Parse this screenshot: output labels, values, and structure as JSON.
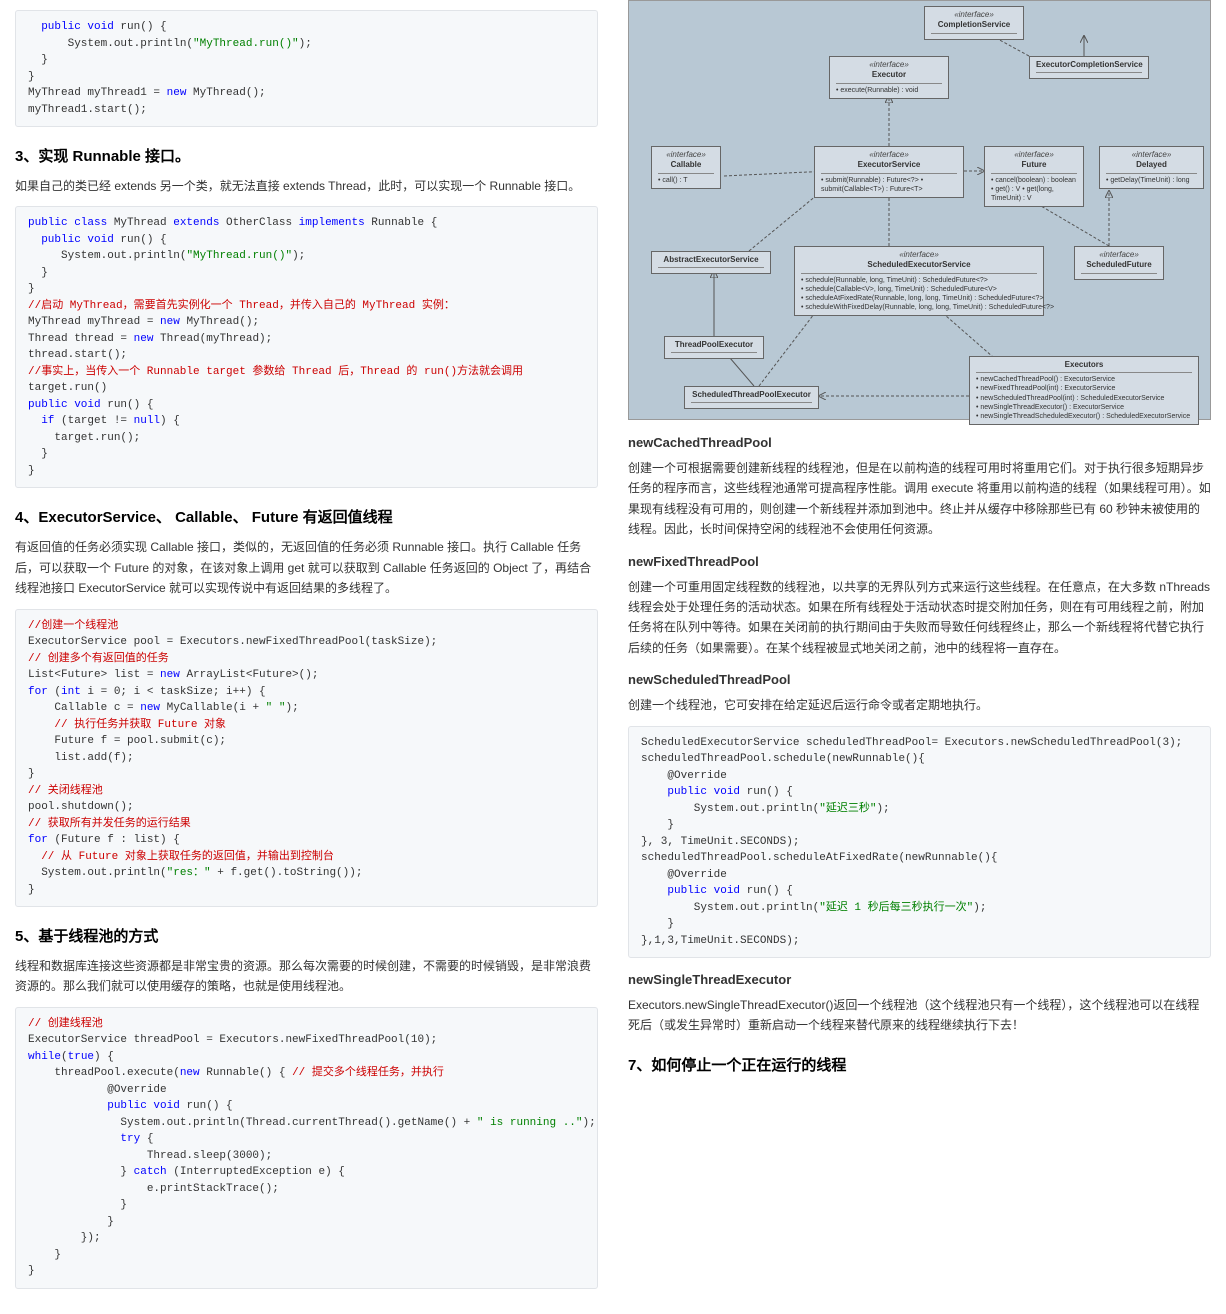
{
  "left": {
    "code1": "  public void run() {\n      System.out.println(\"MyThread.run()\");\n  }\n}\nMyThread myThread1 = new MyThread();\nmyThread1.start();",
    "h3": "3、实现 Runnable 接口。",
    "p3": "如果自己的类已经 extends 另一个类，就无法直接 extends Thread，此时，可以实现一个 Runnable 接口。",
    "code2": "public class MyThread extends OtherClass implements Runnable {\n  public void run() {\n     System.out.println(\"MyThread.run()\");\n  }\n}\n//启动 MyThread，需要首先实例化一个 Thread，并传入自己的 MyThread 实例：\nMyThread myThread = new MyThread();\nThread thread = new Thread(myThread);\nthread.start();\n//事实上，当传入一个 Runnable target 参数给 Thread 后，Thread 的 run()方法就会调用\ntarget.run()\npublic void run() {\n  if (target != null) {\n    target.run();\n  }\n}",
    "h4": "4、ExecutorService、 Callable、 Future 有返回值线程",
    "p4": "有返回值的任务必须实现 Callable 接口，类似的，无返回值的任务必须 Runnable 接口。执行 Callable 任务后，可以获取一个 Future 的对象，在该对象上调用 get 就可以获取到 Callable 任务返回的 Object 了，再结合线程池接口 ExecutorService 就可以实现传说中有返回结果的多线程了。",
    "code3": "//创建一个线程池\nExecutorService pool = Executors.newFixedThreadPool(taskSize);\n// 创建多个有返回值的任务\nList<Future> list = new ArrayList<Future>();\nfor (int i = 0; i < taskSize; i++) {\n    Callable c = new MyCallable(i + \" \");\n    // 执行任务并获取 Future 对象\n    Future f = pool.submit(c);\n    list.add(f);\n}\n// 关闭线程池\npool.shutdown();\n// 获取所有并发任务的运行结果\nfor (Future f : list) {\n  // 从 Future 对象上获取任务的返回值，并输出到控制台\n  System.out.println(\"res：\" + f.get().toString());\n}",
    "h5": "5、基于线程池的方式",
    "p5": "线程和数据库连接这些资源都是非常宝贵的资源。那么每次需要的时候创建，不需要的时候销毁，是非常浪费资源的。那么我们就可以使用缓存的策略，也就是使用线程池。",
    "code4": "// 创建线程池\nExecutorService threadPool = Executors.newFixedThreadPool(10);\nwhile(true) {\n    threadPool.execute(new Runnable() { // 提交多个线程任务，并执行\n            @Override\n            public void run() {\n              System.out.println(Thread.currentThread().getName() + \" is running ..\");\n              try {\n                  Thread.sleep(3000);\n              } catch (InterruptedException e) {\n                  e.printStackTrace();\n              }\n            }\n        });\n    }\n}"
  },
  "right": {
    "uml": {
      "completionService": {
        "iface": "«interface»",
        "name": "CompletionService"
      },
      "executor": {
        "iface": "«interface»",
        "name": "Executor",
        "ops": "• execute(Runnable) : void"
      },
      "executorCompletionService": {
        "name": "ExecutorCompletionService"
      },
      "callable": {
        "iface": "«interface»",
        "name": "Callable",
        "ops": "• call() : T"
      },
      "executorService": {
        "iface": "«interface»",
        "name": "ExecutorService",
        "ops": "• submit(Runnable) : Future<?>\n• submit(Callable<T>) : Future<T>"
      },
      "future": {
        "iface": "«interface»",
        "name": "Future",
        "ops": "• cancel(boolean) : boolean\n• get() : V\n• get(long, TimeUnit) : V"
      },
      "delayed": {
        "iface": "«interface»",
        "name": "Delayed",
        "ops": "• getDelay(TimeUnit) : long"
      },
      "abstractExecutorService": {
        "name": "AbstractExecutorService"
      },
      "scheduledExecutorService": {
        "iface": "«interface»",
        "name": "ScheduledExecutorService",
        "ops": "• schedule(Runnable, long, TimeUnit) : ScheduledFuture<?>\n• schedule(Callable<V>, long, TimeUnit) : ScheduledFuture<V>\n• scheduleAtFixedRate(Runnable, long, long, TimeUnit) : ScheduledFuture<?>\n• scheduleWithFixedDelay(Runnable, long, long, TimeUnit) : ScheduledFuture<?>"
      },
      "scheduledFuture": {
        "iface": "«interface»",
        "name": "ScheduledFuture"
      },
      "threadPoolExecutor": {
        "name": "ThreadPoolExecutor"
      },
      "executors": {
        "name": "Executors",
        "ops": "• newCachedThreadPool() : ExecutorService\n• newFixedThreadPool(int) : ExecutorService\n• newScheduledThreadPool(int) : ScheduledExecutorService\n• newSingleThreadExecutor() : ExecutorService\n• newSingleThreadScheduledExecutor() : ScheduledExecutorService"
      },
      "scheduledThreadPoolExecutor": {
        "name": "ScheduledThreadPoolExecutor"
      }
    },
    "newCached": {
      "h": "newCachedThreadPool",
      "p": "创建一个可根据需要创建新线程的线程池，但是在以前构造的线程可用时将重用它们。对于执行很多短期异步任务的程序而言，这些线程池通常可提高程序性能。调用 execute 将重用以前构造的线程（如果线程可用）。如果现有线程没有可用的，则创建一个新线程并添加到池中。终止并从缓存中移除那些已有 60 秒钟未被使用的线程。因此，长时间保持空闲的线程池不会使用任何资源。"
    },
    "newFixed": {
      "h": "newFixedThreadPool",
      "p": "创建一个可重用固定线程数的线程池，以共享的无界队列方式来运行这些线程。在任意点，在大多数 nThreads 线程会处于处理任务的活动状态。如果在所有线程处于活动状态时提交附加任务，则在有可用线程之前，附加任务将在队列中等待。如果在关闭前的执行期间由于失败而导致任何线程终止，那么一个新线程将代替它执行后续的任务（如果需要）。在某个线程被显式地关闭之前，池中的线程将一直存在。"
    },
    "newScheduled": {
      "h": "newScheduledThreadPool",
      "p": "创建一个线程池，它可安排在给定延迟后运行命令或者定期地执行。"
    },
    "code5": "ScheduledExecutorService scheduledThreadPool= Executors.newScheduledThreadPool(3);\nscheduledThreadPool.schedule(newRunnable(){\n    @Override\n    public void run() {\n        System.out.println(\"延迟三秒\");\n    }\n}, 3, TimeUnit.SECONDS);\nscheduledThreadPool.scheduleAtFixedRate(newRunnable(){\n    @Override\n    public void run() {\n        System.out.println(\"延迟 1 秒后每三秒执行一次\");\n    }\n},1,3,TimeUnit.SECONDS);",
    "newSingle": {
      "h": "newSingleThreadExecutor",
      "p": "Executors.newSingleThreadExecutor()返回一个线程池（这个线程池只有一个线程），这个线程池可以在线程死后（或发生异常时）重新启动一个线程来替代原来的线程继续执行下去！"
    },
    "h7": "7、如何停止一个正在运行的线程"
  }
}
